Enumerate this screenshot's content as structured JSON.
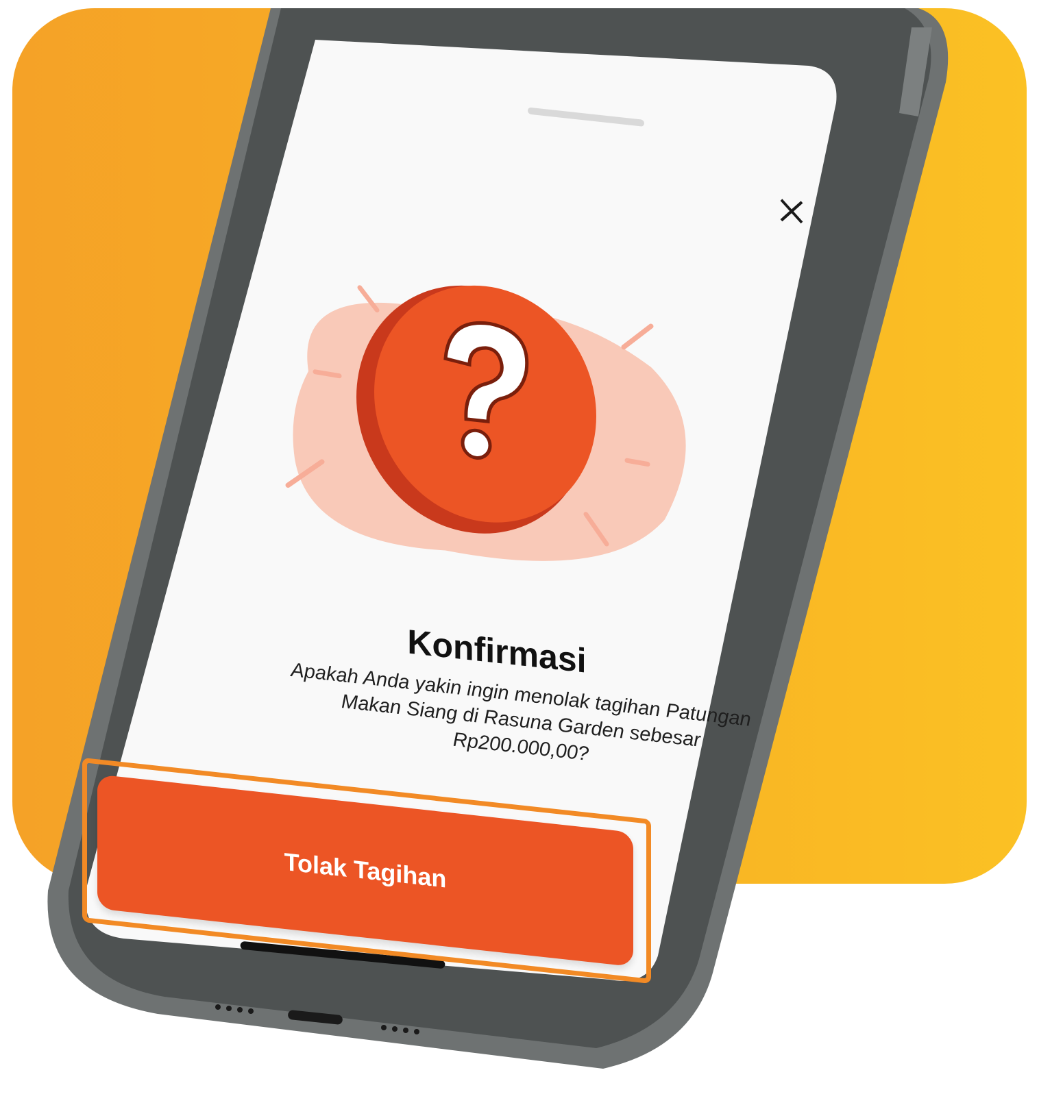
{
  "colors": {
    "backdrop_left": "#f5a227",
    "backdrop_right": "#fbc124",
    "phone_frame": "#4e5252",
    "screen_bg": "#f9f9f9",
    "accent": "#ec5525",
    "highlight_outline": "#f28a25"
  },
  "dialog": {
    "close_icon": "close-icon",
    "illustration_icon": "question-mark-icon",
    "title": "Konfirmasi",
    "message": "Apakah Anda yakin ingin menolak tagihan Patungan Makan Siang di Rasuna Garden sebesar Rp200.000,00?",
    "primary_button": "Tolak Tagihan"
  }
}
